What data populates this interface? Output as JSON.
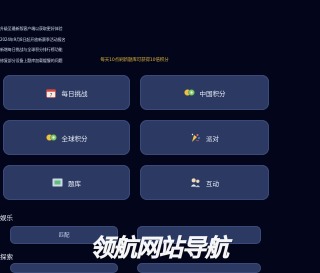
{
  "notices": [
    "升级至最新版客户端以获取更好体验",
    "2024年9月8日起开放新赛季活动报名",
    "新增每日挑战与全球积分排行榜功能",
    "修复部分设备上题库加载缓慢的问题"
  ],
  "banner": "每天10点刷新题库可获得10倍积分",
  "cards": [
    {
      "label": "每日挑战",
      "icon": "calendar-icon"
    },
    {
      "label": "中国积分",
      "icon": "coin-icon"
    },
    {
      "label": "全球积分",
      "icon": "globe-coin-icon"
    },
    {
      "label": "派对",
      "icon": "party-icon"
    },
    {
      "label": "题库",
      "icon": "question-bank-icon"
    },
    {
      "label": "互动",
      "icon": "interaction-icon"
    }
  ],
  "sections": {
    "entertainment": "娱乐",
    "explore": "探索"
  },
  "entertainment_pills": [
    "匹配"
  ],
  "watermark": "领航网站导航",
  "colors": {
    "background": "#03061a",
    "card": "#2c3a63",
    "banner_text": "#d8b13a"
  }
}
